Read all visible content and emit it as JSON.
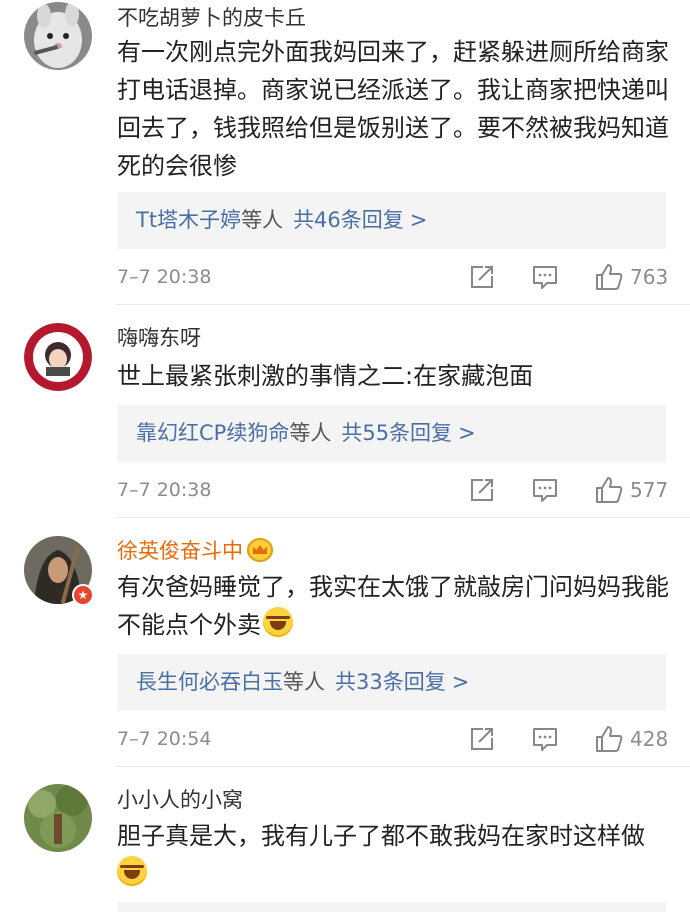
{
  "comments": [
    {
      "username": "不吃胡萝卜的皮卡丘",
      "text": "有一次刚点完外面我妈回来了，赶紧躲进厕所给商家打电话退掉。商家说已经派送了。我让商家把快递叫回去了，钱我照给但是饭别送了。要不然被我妈知道死的会很惨",
      "reply_who": "Tt塔木子婷",
      "reply_mid": "等人",
      "reply_count": "共46条回复",
      "reply_arrow": ">",
      "time": "7–7 20:38",
      "likes": "763"
    },
    {
      "username": "嗨嗨东呀",
      "text": "世上最紧张刺激的事情之二:在家藏泡面",
      "reply_who": "靠幻红CP续狗命",
      "reply_mid": "等人",
      "reply_count": "共55条回复",
      "reply_arrow": ">",
      "time": "7–7 20:38",
      "likes": "577"
    },
    {
      "username": "徐英俊奋斗中",
      "text": "有次爸妈睡觉了，我实在太饿了就敲房门问妈妈我能不能点个外卖",
      "reply_who": "長生何必吞白玉",
      "reply_mid": "等人",
      "reply_count": "共33条回复",
      "reply_arrow": ">",
      "time": "7–7 20:54",
      "likes": "428"
    },
    {
      "username": "小小人的小窝",
      "text": "胆子真是大，我有儿子了都不敢我妈在家时这样做"
    }
  ],
  "colors": {
    "link": "#4a6fa5",
    "vip_name": "#e86b0a",
    "meta": "#8c8c8c",
    "reply_bg": "#f4f4f4"
  },
  "icons": [
    "share-icon",
    "comment-icon",
    "like-icon",
    "crown-badge-icon",
    "laugh-cry-emoji",
    "verified-badge-icon"
  ]
}
